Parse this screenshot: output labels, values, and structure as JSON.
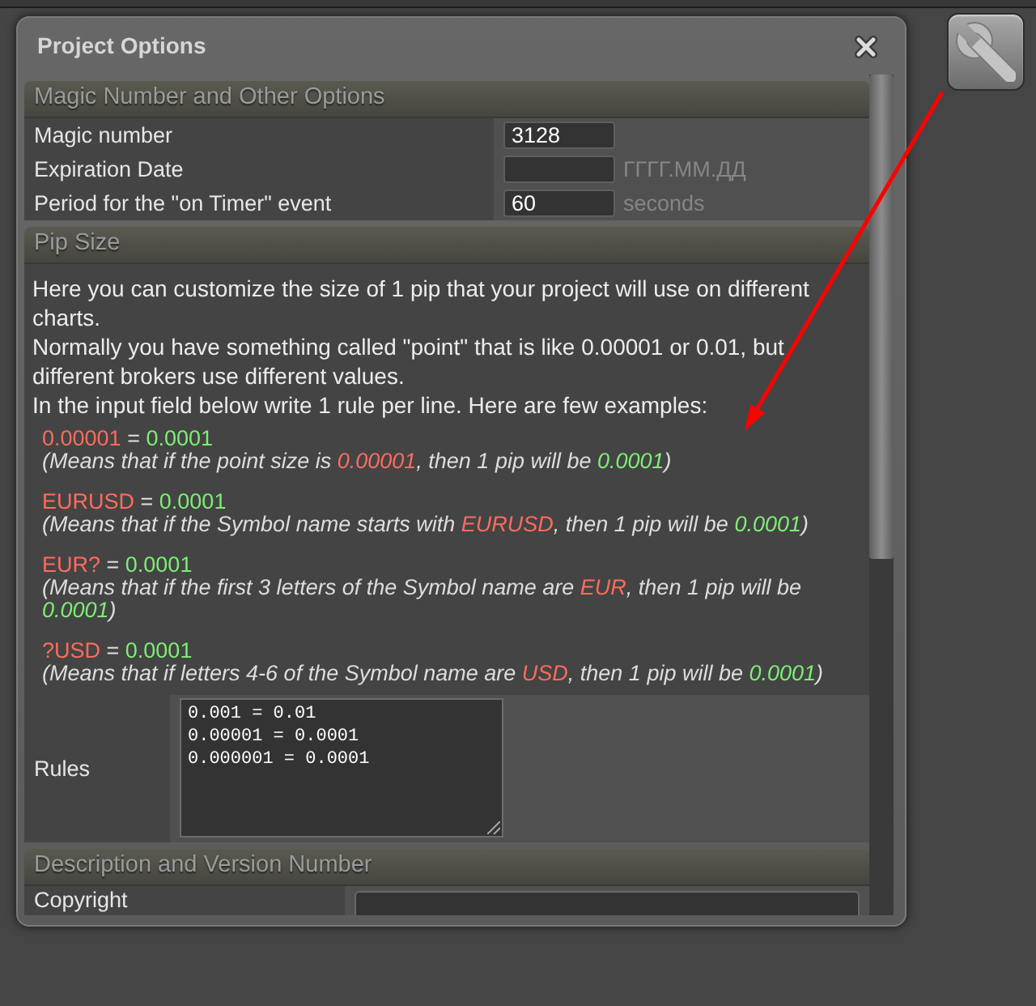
{
  "dialog": {
    "title": "Project Options"
  },
  "sections": [
    {
      "kind": "fields",
      "title": "Magic Number and Other Options",
      "rows": [
        {
          "label": "Magic number",
          "value": "3128"
        },
        {
          "label": "Expiration Date",
          "unit": "ГГГГ.ММ.ДД"
        },
        {
          "label": "Period for the \"on Timer\" event",
          "value": "60",
          "unit": "seconds"
        }
      ]
    },
    {
      "kind": "pip_size",
      "title": "Pip Size",
      "intro": [
        "Here you can customize the size of 1 pip that your project will use on different charts.",
        "Normally you have something called \"point\" that is like 0.00001 or 0.01, but different brokers use different values.",
        "In the input field below write 1 rule per line. Here are few examples:"
      ],
      "examples": [
        {
          "rule": [
            {
              "kind": "symbol",
              "text": "0.00001"
            },
            {
              "kind": "text",
              "text": " = "
            },
            {
              "kind": "pip",
              "text": "0.0001"
            }
          ],
          "explanation": [
            {
              "kind": "text",
              "text": "(Means that if the point size is "
            },
            {
              "kind": "symbol",
              "text": "0.00001"
            },
            {
              "kind": "text",
              "text": ", then 1 pip will be "
            },
            {
              "kind": "pip",
              "text": "0.0001"
            },
            {
              "kind": "text",
              "text": ")"
            }
          ]
        },
        {
          "rule": [
            {
              "kind": "symbol",
              "text": "EURUSD"
            },
            {
              "kind": "text",
              "text": " = "
            },
            {
              "kind": "pip",
              "text": "0.0001"
            }
          ],
          "explanation": [
            {
              "kind": "text",
              "text": "(Means that if the Symbol name starts with "
            },
            {
              "kind": "symbol",
              "text": "EURUSD"
            },
            {
              "kind": "text",
              "text": ", then 1 pip will be "
            },
            {
              "kind": "pip",
              "text": "0.0001"
            },
            {
              "kind": "text",
              "text": ")"
            }
          ]
        },
        {
          "rule": [
            {
              "kind": "symbol",
              "text": "EUR?"
            },
            {
              "kind": "text",
              "text": " = "
            },
            {
              "kind": "pip",
              "text": "0.0001"
            }
          ],
          "explanation": [
            {
              "kind": "text",
              "text": "(Means that if the first 3 letters of the Symbol name are "
            },
            {
              "kind": "symbol",
              "text": "EUR"
            },
            {
              "kind": "text",
              "text": ", then 1 pip will be "
            },
            {
              "kind": "pip",
              "text": "0.0001"
            },
            {
              "kind": "text",
              "text": ")"
            }
          ]
        },
        {
          "rule": [
            {
              "kind": "symbol",
              "text": "?USD"
            },
            {
              "kind": "text",
              "text": " = "
            },
            {
              "kind": "pip",
              "text": "0.0001"
            }
          ],
          "explanation": [
            {
              "kind": "text",
              "text": "(Means that if letters 4-6 of the Symbol name are "
            },
            {
              "kind": "symbol",
              "text": "USD"
            },
            {
              "kind": "text",
              "text": ", then 1 pip will be "
            },
            {
              "kind": "pip",
              "text": "0.0001"
            },
            {
              "kind": "text",
              "text": ")"
            }
          ]
        }
      ],
      "rules": {
        "label": "Rules",
        "lines": [
          "0.001 = 0.01",
          "0.00001 = 0.0001",
          "0.000001 = 0.0001"
        ]
      }
    },
    {
      "kind": "fields",
      "title": "Description and Version Number",
      "rows": [
        {
          "label": "Copyright"
        }
      ]
    }
  ]
}
